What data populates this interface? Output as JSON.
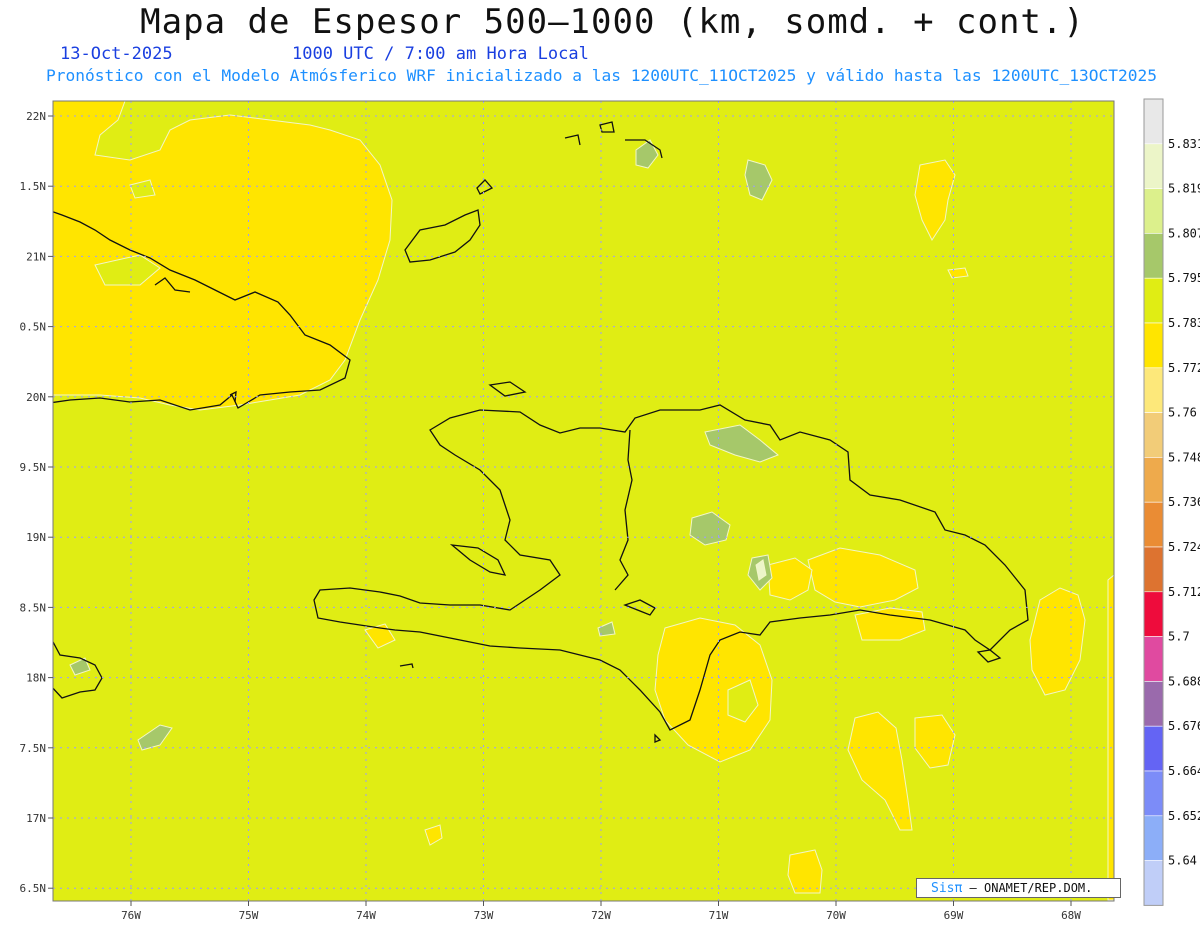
{
  "header": {
    "title": "Mapa de Espesor 500—1000 (km, somd. + cont.)",
    "date": "13-Oct-2025",
    "time": "1000 UTC / 7:00 am Hora Local",
    "forecast": "Pronóstico con el Modelo Atmósferico WRF inicializado a las 1200UTC_11OCT2025 y válido hasta las  1200UTC_13OCT2025"
  },
  "map": {
    "lat_labels": [
      "22N",
      "1.5N",
      "21N",
      "0.5N",
      "20N",
      "9.5N",
      "19N",
      "8.5N",
      "18N",
      "7.5N",
      "17N",
      "6.5N"
    ],
    "lon_labels": [
      "76W",
      "75W",
      "74W",
      "73W",
      "72W",
      "71W",
      "70W",
      "69W",
      "68W"
    ],
    "colors": {
      "main_field": "#e0ed14",
      "warm_field": "#ffe500",
      "cool_field": "#a6c86a",
      "coast": "#111111",
      "contour": "#f2f6c8",
      "grid": "#9a9aff"
    }
  },
  "colorbar": {
    "labels": [
      "5.831",
      "5.819",
      "5.807",
      "5.795",
      "5.783",
      "5.772",
      "5.76",
      "5.748",
      "5.736",
      "5.724",
      "5.712",
      "5.7",
      "5.688",
      "5.676",
      "5.664",
      "5.652",
      "5.64"
    ],
    "colors": [
      "#e8e8e8",
      "#ecf5c8",
      "#dcf08c",
      "#a6c86a",
      "#e0ed14",
      "#ffe500",
      "#fde87a",
      "#f2cc78",
      "#eeaa4c",
      "#ea8c34",
      "#dd7330",
      "#ee0c3c",
      "#e04aa0",
      "#9a6aac",
      "#6464f4",
      "#7c8cf8",
      "#8caef8",
      "#c0cef8"
    ]
  },
  "footer": {
    "brand": "Sisπ",
    "credit": "— ONAMET/REP.DOM."
  }
}
